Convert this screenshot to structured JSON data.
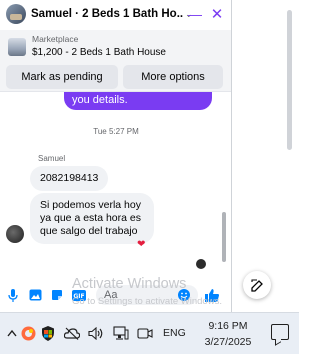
{
  "header": {
    "title": "Samuel · 2 Beds 1 Bath Ho...",
    "icons": [
      "chevron-down-icon",
      "minimize-icon",
      "close-icon"
    ]
  },
  "listing": {
    "source": "Marketplace",
    "title": "$1,200 - 2 Beds 1 Bath House",
    "mark_pending_label": "Mark as pending",
    "more_options_label": "More options"
  },
  "messages": {
    "previous_outgoing": "you details.",
    "timestamp": "Tue 5:27 PM",
    "sender": "Samuel",
    "msg1": "2082198413",
    "msg2_line1": "Si podemos verla hoy",
    "msg2_line2": "ya que a esta hora es",
    "msg2_line3": "que salgo del trabajo",
    "reaction": "❤"
  },
  "composer": {
    "placeholder": "Aa",
    "icons": [
      "microphone-icon",
      "image-icon",
      "sticker-icon",
      "gif-icon",
      "emoji-icon",
      "like-icon"
    ]
  },
  "watermark": {
    "title": "Activate Windows",
    "subtitle": "Go to Settings to activate Windows."
  },
  "taskbar": {
    "language": "ENG",
    "time": "9:16 PM",
    "date": "3/27/2025"
  },
  "colors": {
    "accent": "#7a3cf2",
    "messenger_blue": "#0084ff",
    "bubble_incoming": "#f0f2f5",
    "heart": "#e41e3f"
  }
}
